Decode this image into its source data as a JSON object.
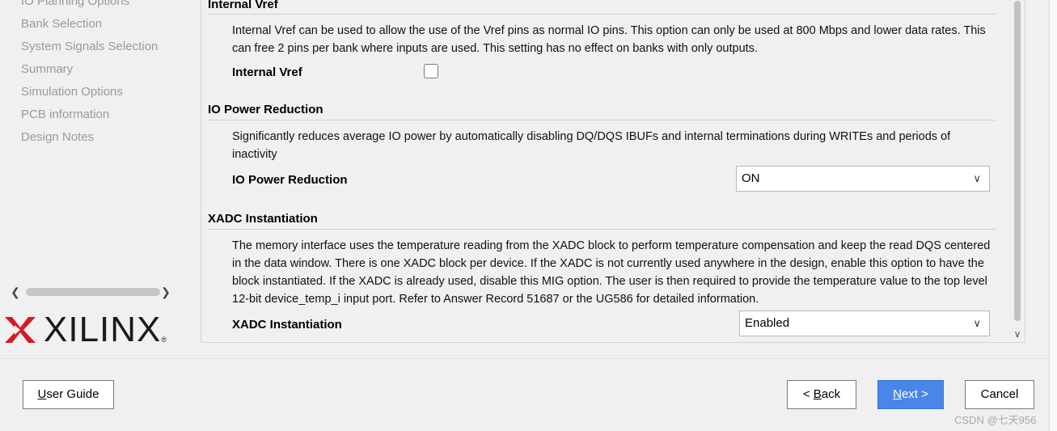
{
  "sidebar": {
    "items": [
      {
        "label": "IO Planning Options"
      },
      {
        "label": "Bank Selection"
      },
      {
        "label": "System Signals Selection"
      },
      {
        "label": "Summary"
      },
      {
        "label": "Simulation Options"
      },
      {
        "label": "PCB information"
      },
      {
        "label": "Design Notes"
      }
    ],
    "logo_text": "XILINX",
    "logo_mark": "®"
  },
  "sections": {
    "internal_vref": {
      "title": "Internal Vref",
      "description": "Internal Vref can be used to allow the use of the Vref pins as normal IO pins. This option can only be used at 800 Mbps and lower data rates. This can free 2 pins per bank where inputs are used. This setting has no effect on banks with only outputs.",
      "field_label": "Internal Vref",
      "checked": false
    },
    "io_power": {
      "title": "IO Power Reduction",
      "description": "Significantly reduces average IO power by automatically disabling DQ/DQS IBUFs and internal terminations during WRITEs and periods of inactivity",
      "field_label": "IO Power Reduction",
      "value": "ON"
    },
    "xadc": {
      "title": "XADC Instantiation",
      "description": "The memory interface uses the temperature reading from the XADC block to perform temperature compensation and keep the read DQS centered in the data window. There is one XADC block per device. If the XADC is not currently used anywhere in the design, enable this option to have the block instantiated. If the XADC is already used, disable this MIG option. The user is then required to provide the temperature value to the top level 12-bit device_temp_i input port. Refer to Answer Record 51687 or the UG586 for detailed information.",
      "field_label": "XADC Instantiation",
      "value": "Enabled"
    }
  },
  "buttons": {
    "user_guide": {
      "before": "",
      "mnemonic": "U",
      "after": "ser Guide"
    },
    "back": {
      "before": "< ",
      "mnemonic": "B",
      "after": "ack"
    },
    "next": {
      "before": "",
      "mnemonic": "N",
      "after": "ext >"
    },
    "cancel": {
      "before": "Cancel",
      "mnemonic": "",
      "after": ""
    }
  },
  "watermark": "CSDN @七天956",
  "colors": {
    "accent": "#4a86e8",
    "nav_text": "#9a9a9a",
    "xilinx_red": "#d71920"
  },
  "icons": {
    "dropdown": "chevron-down-icon",
    "scroll_left": "chevron-left-icon",
    "scroll_right": "chevron-right-icon",
    "scroll_down": "chevron-down-icon"
  }
}
